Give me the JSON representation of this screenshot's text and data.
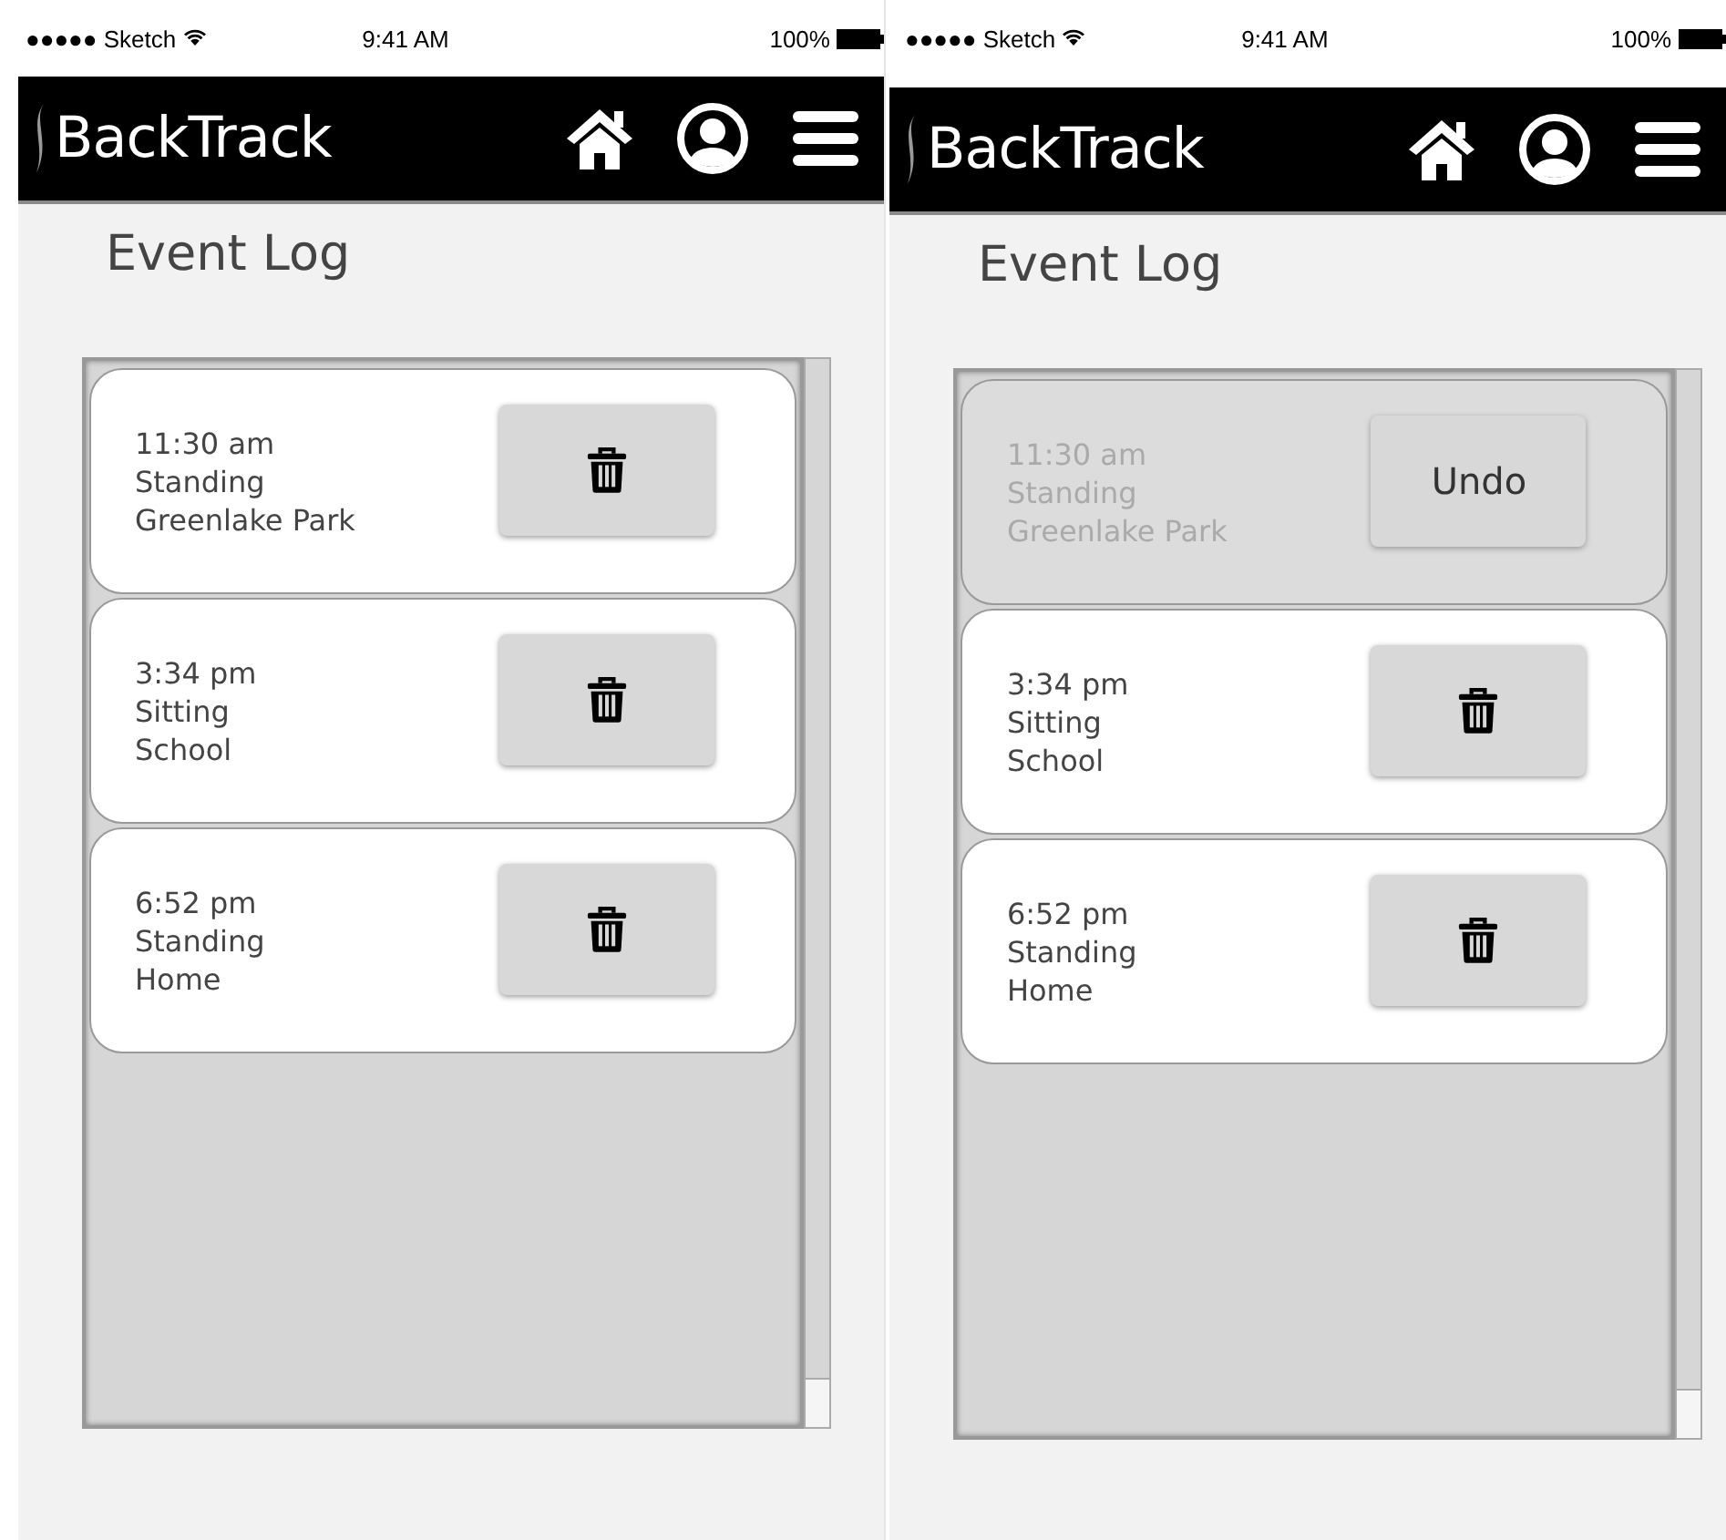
{
  "screens": [
    {
      "status_bar": {
        "carrier": "●●●●● Sketch",
        "time": "9:41 AM",
        "battery": "100%"
      },
      "app_title": "BackTrack",
      "page_title": "Event Log",
      "events": [
        {
          "time": "11:30 am",
          "activity": "Standing",
          "location": "Greenlake Park",
          "deleted": false
        },
        {
          "time": "3:34 pm",
          "activity": "Sitting",
          "location": "School",
          "deleted": false
        },
        {
          "time": "6:52 pm",
          "activity": "Standing",
          "location": "Home",
          "deleted": false
        }
      ]
    },
    {
      "status_bar": {
        "carrier": "●●●●● Sketch",
        "time": "9:41 AM",
        "battery": "100%"
      },
      "app_title": "BackTrack",
      "page_title": "Event Log",
      "events": [
        {
          "time": "11:30 am",
          "activity": "Standing",
          "location": "Greenlake Park",
          "deleted": true,
          "undo_label": "Undo"
        },
        {
          "time": "3:34 pm",
          "activity": "Sitting",
          "location": "School",
          "deleted": false
        },
        {
          "time": "6:52 pm",
          "activity": "Standing",
          "location": "Home",
          "deleted": false
        }
      ]
    }
  ]
}
